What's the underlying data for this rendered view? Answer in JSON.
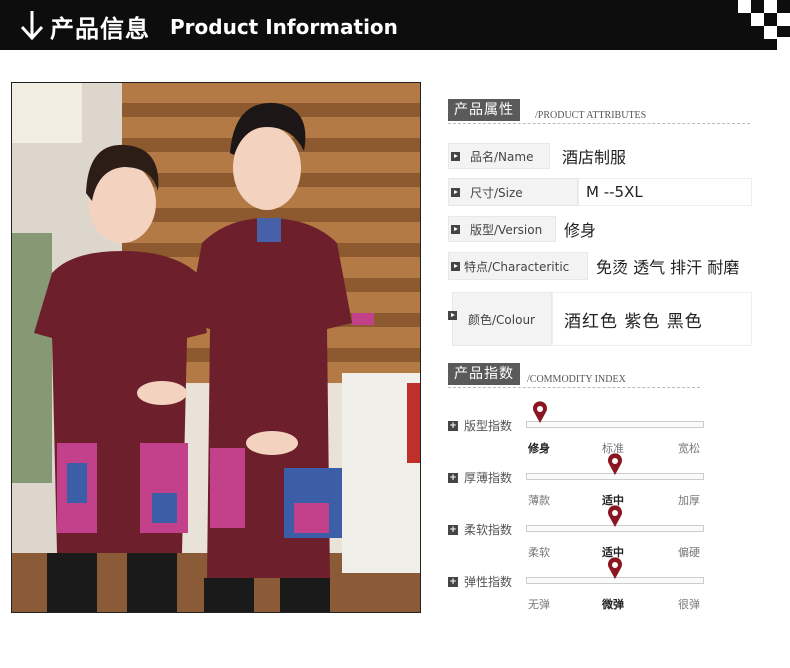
{
  "header": {
    "title_cn": "产品信息",
    "title_en": "Product Information"
  },
  "photo": {
    "alt": "two staff wearing wine-red uniforms with patchwork pockets"
  },
  "attributes_section": {
    "title": "产品属性",
    "subtitle": "/PRODUCT ATTRIBUTES",
    "rows": [
      {
        "label": "品名/Name",
        "value": "酒店制服"
      },
      {
        "label": "尺寸/Size",
        "value": "M --5XL"
      },
      {
        "label": "版型/Version",
        "value": "修身"
      },
      {
        "label": "特点/Characteritic",
        "value": "免烫  透气 排汗 耐磨"
      },
      {
        "label": "颜色/Colour",
        "value": "酒红色  紫色  黑色"
      }
    ]
  },
  "index_section": {
    "title": "产品指数",
    "subtitle": "/COMMODITY INDEX",
    "rows": [
      {
        "label": "版型指数",
        "options": [
          "修身",
          "标准",
          "宽松"
        ],
        "selected": 0
      },
      {
        "label": "厚薄指数",
        "options": [
          "薄款",
          "适中",
          "加厚"
        ],
        "selected": 1
      },
      {
        "label": "柔软指数",
        "options": [
          "柔软",
          "适中",
          "偏硬"
        ],
        "selected": 1
      },
      {
        "label": "弹性指数",
        "options": [
          "无弹",
          "微弹",
          "很弹"
        ],
        "selected": 1
      }
    ]
  },
  "colors": {
    "banner_bg": "#0d0d0d",
    "uniform": "#6e1f2c",
    "pin": "#8b1520"
  },
  "icons": [
    "down-arrow-icon",
    "play-bullet-icon",
    "plus-icon",
    "map-pin-icon"
  ]
}
